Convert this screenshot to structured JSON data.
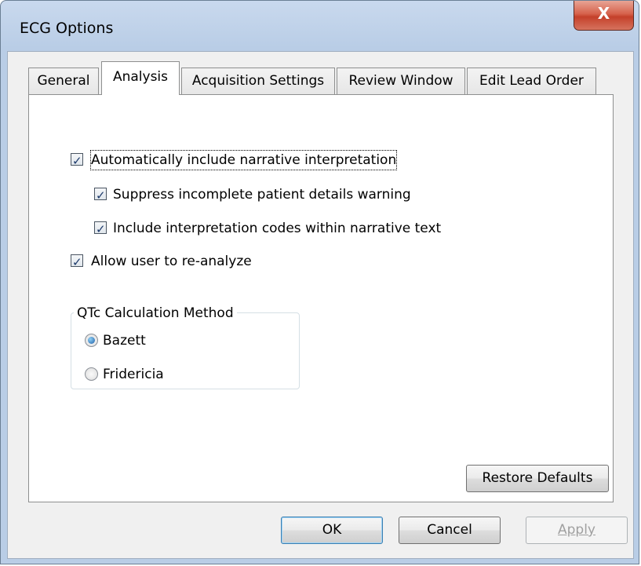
{
  "window": {
    "title": "ECG Options",
    "close_glyph": "X"
  },
  "tabs": [
    {
      "label": "General",
      "active": false
    },
    {
      "label": "Analysis",
      "active": true
    },
    {
      "label": "Acquisition Settings",
      "active": false
    },
    {
      "label": "Review Window",
      "active": false
    },
    {
      "label": "Edit Lead Order",
      "active": false
    }
  ],
  "analysis": {
    "auto_narrative": {
      "label": "Automatically include narrative interpretation",
      "checked": true
    },
    "suppress_warning": {
      "label": "Suppress incomplete patient details warning",
      "checked": true
    },
    "include_codes": {
      "label": "Include interpretation codes within narrative text",
      "checked": true
    },
    "allow_reanalyze": {
      "label": "Allow user to re-analyze",
      "checked": true
    },
    "qtc_group": {
      "legend": "QTc Calculation Method",
      "options": [
        {
          "label": "Bazett",
          "selected": true
        },
        {
          "label": "Fridericia",
          "selected": false
        }
      ]
    },
    "restore_defaults_label": "Restore Defaults"
  },
  "footer": {
    "ok_label": "OK",
    "cancel_label": "Cancel",
    "apply_label": "Apply",
    "apply_enabled": false
  },
  "icons": {
    "checkmark": "check-icon",
    "radio_dot": "radio-dot-icon",
    "close": "close-icon"
  }
}
